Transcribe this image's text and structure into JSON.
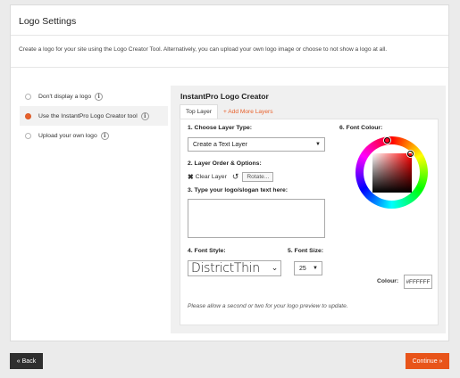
{
  "panel": {
    "title": "Logo Settings",
    "intro": "Create a logo for your site using the Logo Creator Tool. Alternatively, you can upload your own logo image or choose to not show a logo at all."
  },
  "options": [
    {
      "label": "Don't display a logo",
      "selected": false
    },
    {
      "label": "Use the InstantPro Logo Creator tool",
      "selected": true
    },
    {
      "label": "Upload your own logo",
      "selected": false
    }
  ],
  "info_glyph": "i",
  "creator": {
    "title": "InstantPro Logo Creator",
    "tabs": {
      "active": "Top Layer",
      "add": "+ Add More Layers"
    },
    "layer_type_label": "1. Choose Layer Type:",
    "layer_type_value": "Create a Text Layer",
    "layer_order_label": "2. Layer Order & Options:",
    "clear_layer": "Clear Layer",
    "rotate": "Rotate...",
    "text_label": "3. Type your logo/slogan text here:",
    "text_value": "",
    "font_style_label": "4. Font Style:",
    "font_style_value": "DistrictThin",
    "font_size_label": "5. Font Size:",
    "font_size_value": "25",
    "font_colour_label": "6. Font Colour:",
    "colour_label": "Colour:",
    "colour_value": "#FFFFFF",
    "note": "Please allow a second or two for your logo preview to update."
  },
  "buttons": {
    "back": "« Back",
    "continue": "Continue »"
  },
  "colors": {
    "accent": "#e8541a",
    "back_button": "#2f2f2f"
  }
}
